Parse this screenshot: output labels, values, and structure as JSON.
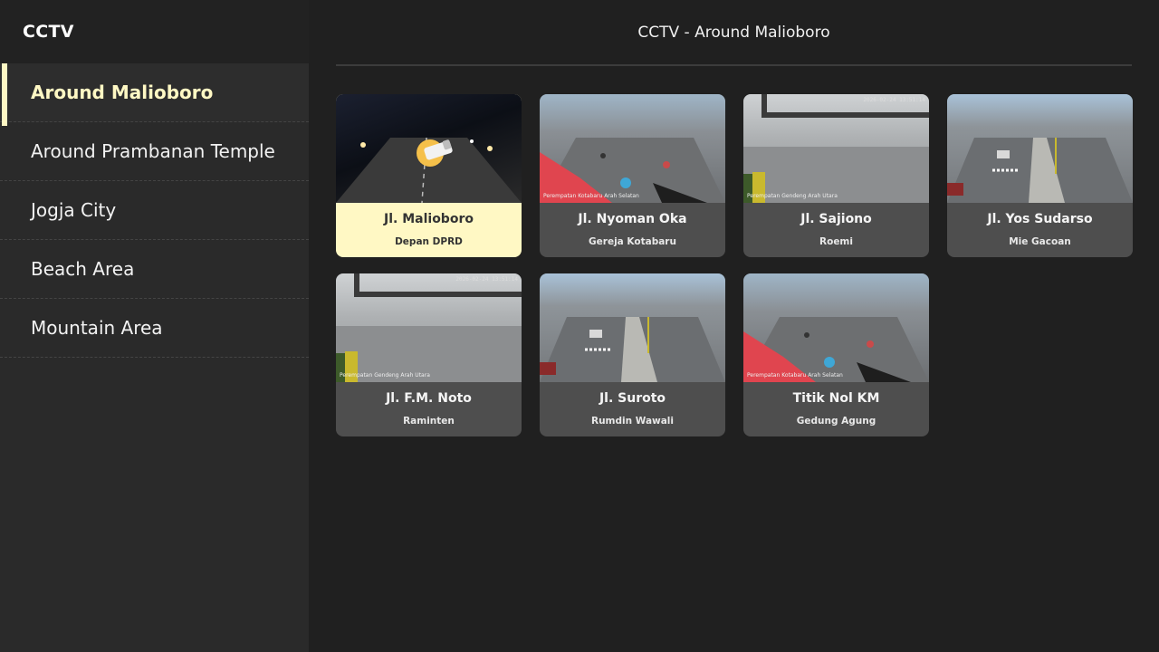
{
  "app": {
    "title": "CCTV"
  },
  "sidebar": {
    "items": [
      {
        "label": "Around Malioboro",
        "active": true
      },
      {
        "label": "Around Prambanan Temple",
        "active": false
      },
      {
        "label": "Jogja City",
        "active": false
      },
      {
        "label": "Beach Area",
        "active": false
      },
      {
        "label": "Mountain Area",
        "active": false
      }
    ]
  },
  "main": {
    "title": "CCTV - Around Malioboro",
    "cameras": [
      {
        "name": "Jl. Malioboro",
        "location": "Depan DPRD",
        "selected": true,
        "scene": "night",
        "overlay_icon": "camera-icon"
      },
      {
        "name": "Jl. Nyoman Oka",
        "location": "Gereja Kotabaru",
        "selected": false,
        "scene": "street",
        "caption": "Perempatan Kotabaru Arah Selatan"
      },
      {
        "name": "Jl. Sajiono",
        "location": "Roemi",
        "selected": false,
        "scene": "gray",
        "caption": "Perempatan Gendeng Arah Utara",
        "stamp": "2026-02-24 13:51:14"
      },
      {
        "name": "Jl. Yos Sudarso",
        "location": "Mie Gacoan",
        "selected": false,
        "scene": "road"
      },
      {
        "name": "Jl. F.M. Noto",
        "location": "Raminten",
        "selected": false,
        "scene": "gray",
        "caption": "Perempatan Gendeng Arah Utara",
        "stamp": "2026-02-24 13:51:14"
      },
      {
        "name": "Jl. Suroto",
        "location": "Rumdin Wawali",
        "selected": false,
        "scene": "road"
      },
      {
        "name": "Titik Nol KM",
        "location": "Gedung Agung",
        "selected": false,
        "scene": "street",
        "caption": "Perempatan Kotabaru Arah Selatan"
      }
    ]
  },
  "colors": {
    "accent": "#fff8c4",
    "sidebar_bg": "#2a2a2a",
    "main_bg": "#202020",
    "card_bg": "#4e4e4e"
  }
}
